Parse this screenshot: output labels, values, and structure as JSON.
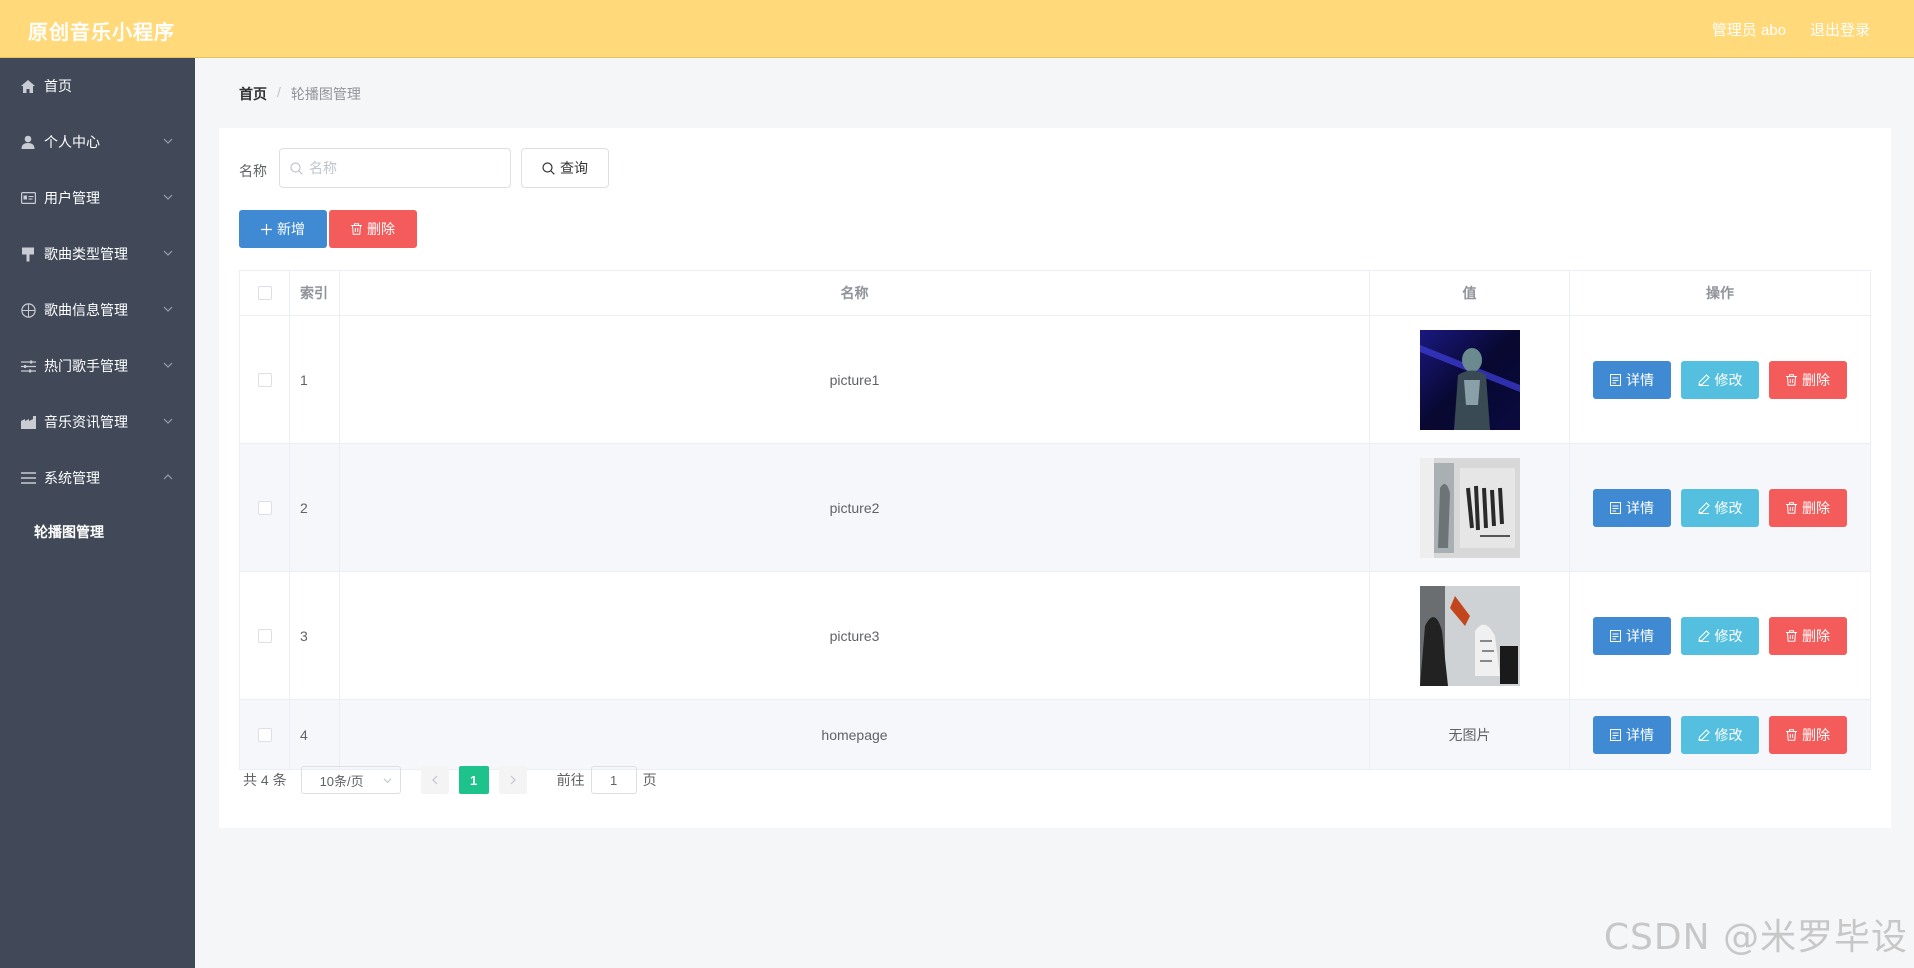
{
  "header": {
    "title": "原创音乐小程序",
    "user": "管理员 abo",
    "logout": "退出登录"
  },
  "sidebar": {
    "items": [
      {
        "label": "首页",
        "icon": "home-icon"
      },
      {
        "label": "个人中心",
        "icon": "user-icon"
      },
      {
        "label": "用户管理",
        "icon": "id-card-icon"
      },
      {
        "label": "歌曲类型管理",
        "icon": "brush-icon"
      },
      {
        "label": "歌曲信息管理",
        "icon": "basketball-icon"
      },
      {
        "label": "热门歌手管理",
        "icon": "sliders-icon"
      },
      {
        "label": "音乐资讯管理",
        "icon": "factory-icon"
      },
      {
        "label": "系统管理",
        "icon": "menu-icon"
      }
    ],
    "sub_item": "轮播图管理"
  },
  "breadcrumb": {
    "home": "首页",
    "sep": "/",
    "current": "轮播图管理"
  },
  "search": {
    "label": "名称",
    "placeholder": "名称",
    "button": "查询"
  },
  "toolbar": {
    "add": "新增",
    "delete": "删除"
  },
  "table": {
    "headers": {
      "index": "索引",
      "name": "名称",
      "value": "值",
      "ops": "操作"
    },
    "rows": [
      {
        "index": "1",
        "name": "picture1",
        "value": ""
      },
      {
        "index": "2",
        "name": "picture2",
        "value": ""
      },
      {
        "index": "3",
        "name": "picture3",
        "value": ""
      },
      {
        "index": "4",
        "name": "homepage",
        "value": "无图片"
      }
    ],
    "ops": {
      "detail": "详情",
      "edit": "修改",
      "delete": "删除"
    }
  },
  "pagination": {
    "total": "共 4 条",
    "page_size": "10条/页",
    "current_page": "1",
    "goto_label": "前往",
    "goto_value": "1",
    "page_suffix": "页"
  },
  "watermark": "CSDN @米罗毕设",
  "colors": {
    "header_bg": "#ffd97a",
    "sidebar_bg": "#414959",
    "primary": "#3f8ad3",
    "info": "#55bfdf",
    "danger": "#f45b5b",
    "page_active": "#1ec28b"
  }
}
